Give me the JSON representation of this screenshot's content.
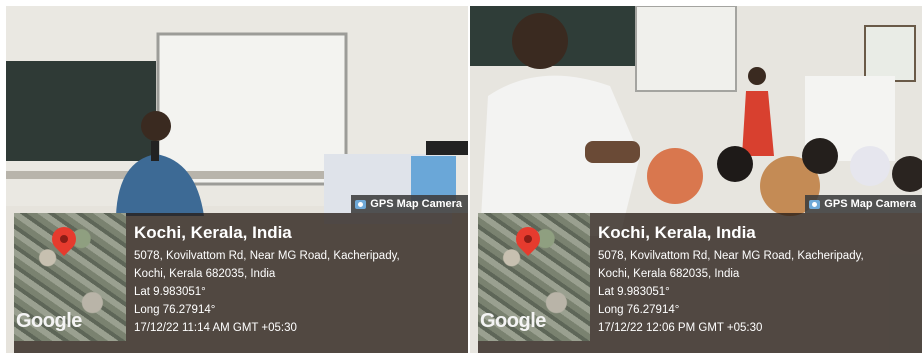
{
  "photos": [
    {
      "badge": "GPS Map Camera",
      "city": "Kochi, Kerala, India",
      "address1": "5078, Kovilvattom Rd, Near MG Road, Kacheripady,",
      "address2": "Kochi, Kerala 682035, India",
      "lat": "Lat 9.983051°",
      "long": "Long 76.27914°",
      "timestamp": "17/12/22 11:14 AM GMT +05:30",
      "map_logo": "Google"
    },
    {
      "badge": "GPS Map Camera",
      "city": "Kochi, Kerala, India",
      "address1": "5078, Kovilvattom Rd, Near MG Road, Kacheripady,",
      "address2": "Kochi, Kerala 682035, India",
      "lat": "Lat 9.983051°",
      "long": "Long 76.27914°",
      "timestamp": "17/12/22 12:06 PM GMT +05:30",
      "map_logo": "Google"
    }
  ]
}
